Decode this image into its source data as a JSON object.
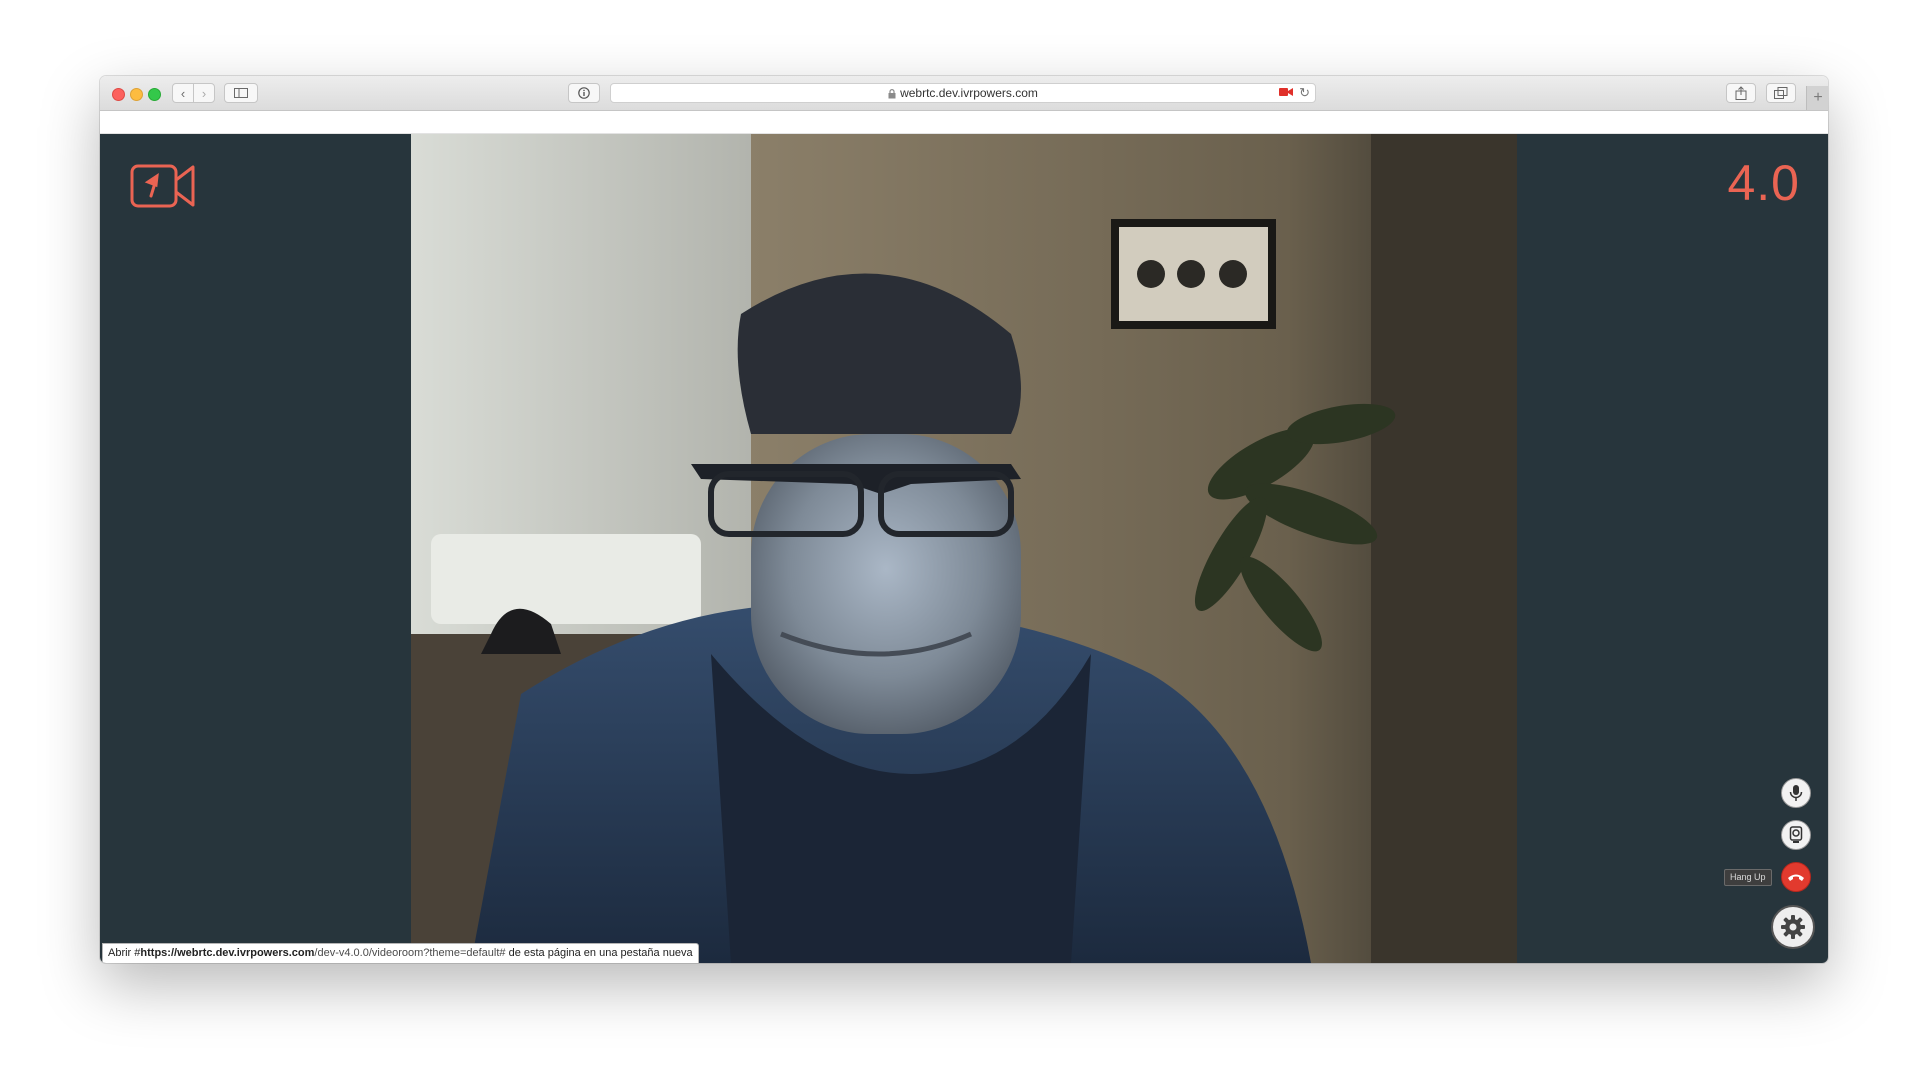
{
  "browser": {
    "url": "webrtc.dev.ivrpowers.com",
    "status_bar": {
      "prefix": "Abrir #",
      "host": "https://webrtc.dev.ivrpowers.com",
      "path": "/dev-v4.0.0/videoroom?theme=default#",
      "suffix": " de esta página en una pestaña nueva"
    },
    "new_tab_label": "+"
  },
  "app": {
    "logo_icon": "video-camera-logo-icon",
    "version": "4.0",
    "colors": {
      "background": "#27353c",
      "accent": "#ea6453",
      "hangup": "#e23a2e"
    },
    "controls": {
      "mic_icon": "microphone-icon",
      "camera_icon": "webcam-icon",
      "hangup_icon": "phone-hangup-icon",
      "hangup_tooltip": "Hang Up",
      "settings_icon": "gear-icon"
    }
  }
}
